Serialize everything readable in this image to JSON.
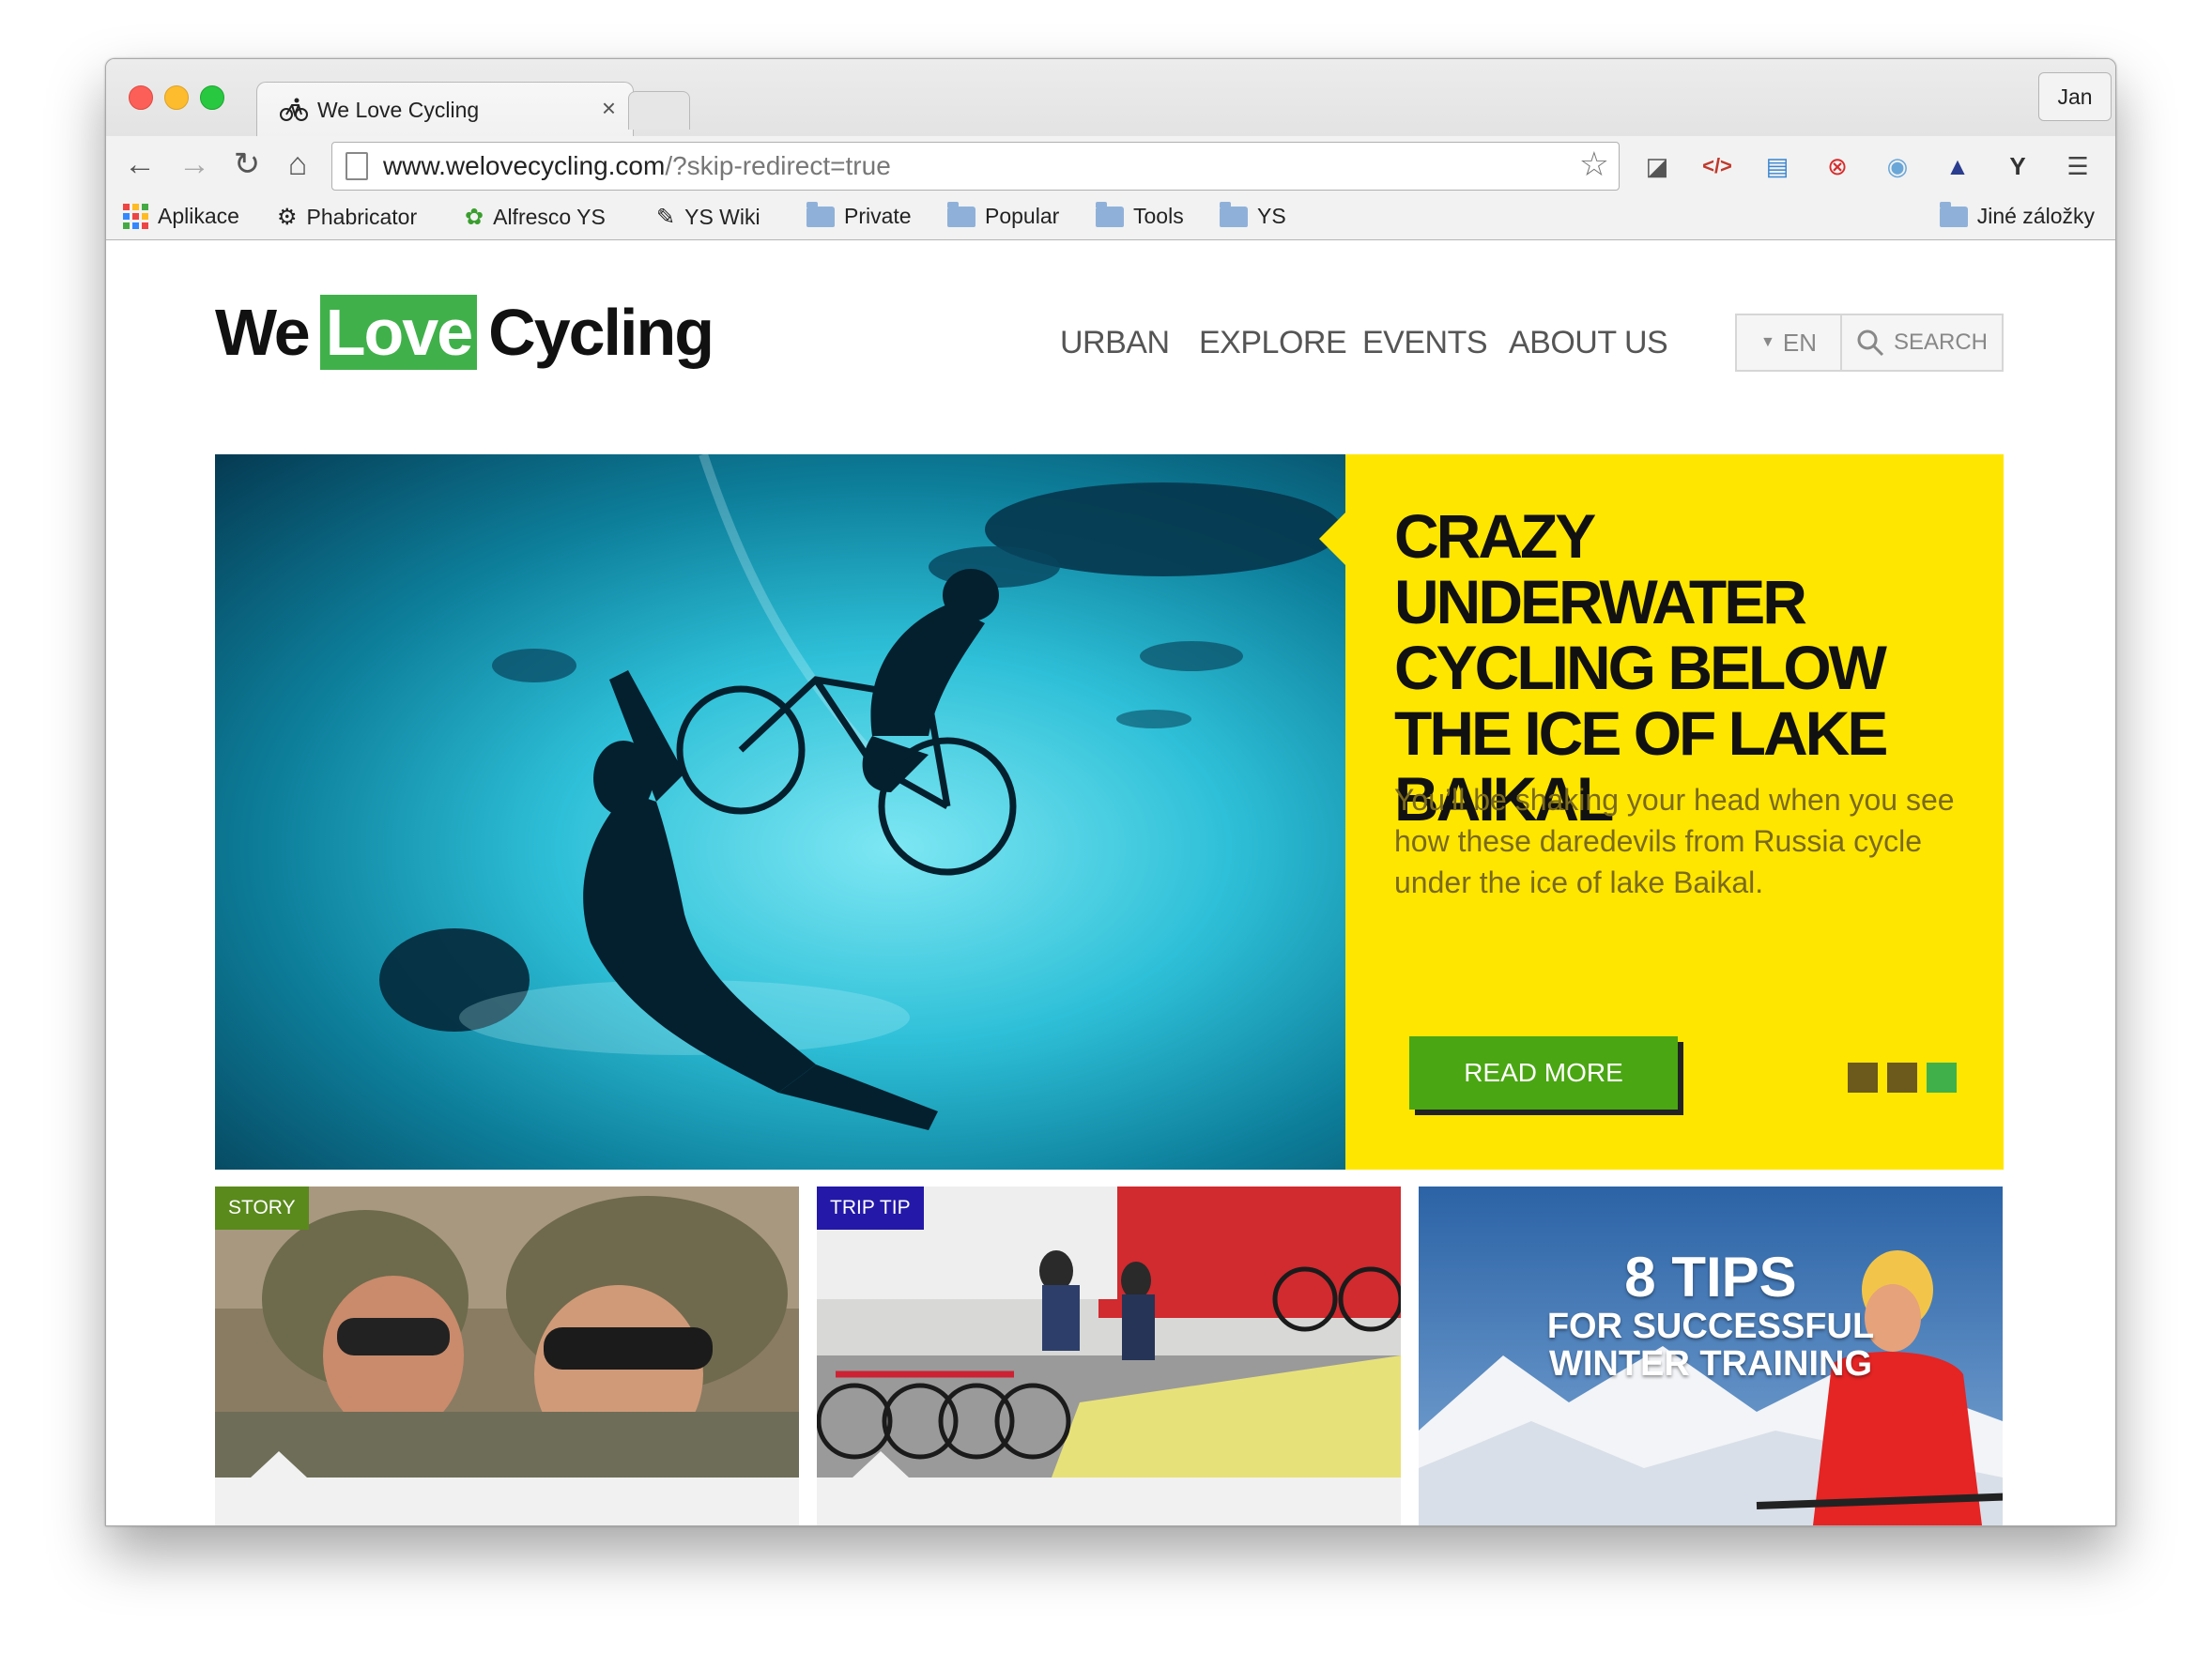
{
  "browser": {
    "tab_title": "We Love Cycling",
    "tab_close": "×",
    "profile": "Jan",
    "url_host": "www.welovecycling.com",
    "url_path": "/?skip-redirect=true",
    "bookmarks": [
      "Aplikace",
      "Phabricator",
      "Alfresco YS",
      "YS Wiki",
      "Private",
      "Popular",
      "Tools",
      "YS"
    ],
    "other_bookmarks": "Jiné záložky"
  },
  "site": {
    "logo_we": "We",
    "logo_love": "Love",
    "logo_cycling": "Cycling",
    "nav": [
      "URBAN",
      "EXPLORE",
      "EVENTS",
      "ABOUT US"
    ],
    "lang": "EN",
    "search_label": "SEARCH"
  },
  "hero": {
    "title": "CRAZY UNDERWATER CYCLING BELOW THE ICE OF LAKE BAIKAL",
    "description": "You’ll be shaking your head when you see how these daredevils from Russia cycle under the ice of lake Baikal.",
    "button": "READ MORE",
    "slides_total": 3,
    "slide_active_index": 2
  },
  "cards": [
    {
      "tag": "STORY"
    },
    {
      "tag": "TRIP TIP"
    },
    {
      "tips_number": "8 TIPS",
      "tips_line1": "FOR SUCCESSFUL",
      "tips_line2": "WINTER TRAINING"
    }
  ],
  "colors": {
    "brand_green": "#40b14a",
    "hero_yellow": "#ffe600",
    "button_green": "#4aa612",
    "dot_inactive": "#6b5a1b",
    "dot_active": "#40b14a",
    "story_tag": "#5a8a1c",
    "trip_tag": "#2318a8"
  }
}
